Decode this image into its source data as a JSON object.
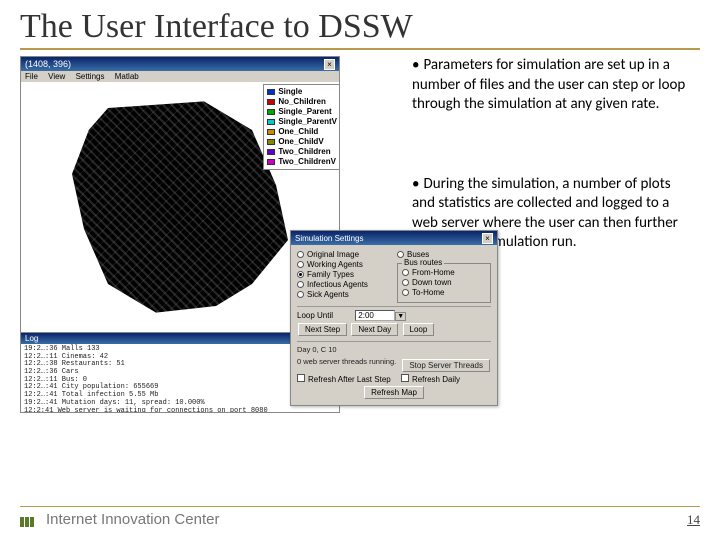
{
  "title": "The User Interface to DSSW",
  "bullets": [
    "Parameters for simulation are set up in a number of files and the user can step or loop through the simulation at any given rate.",
    "During the simulation, a number of plots and statistics are collected and logged to a web server where the user can then further analyze the simulation run."
  ],
  "app": {
    "title": "(1408, 396)",
    "menus": [
      "File",
      "View",
      "Settings",
      "Matlab"
    ],
    "legend": [
      {
        "label": "Single",
        "color": "#0033cc"
      },
      {
        "label": "No_Children",
        "color": "#cc0000"
      },
      {
        "label": "Single_Parent",
        "color": "#00aa00"
      },
      {
        "label": "Single_ParentV",
        "color": "#00cccc"
      },
      {
        "label": "One_Child",
        "color": "#cc8800"
      },
      {
        "label": "One_ChildV",
        "color": "#888800"
      },
      {
        "label": "Two_Children",
        "color": "#6600cc"
      },
      {
        "label": "Two_ChildrenV",
        "color": "#cc00cc"
      }
    ],
    "log_title": "Log",
    "log_lines": [
      "19:2…:36 Malls 133",
      "12:2…:11 Cinemas: 42",
      "12:2…:38 Restaurants: 51",
      "12:2…:36 Cars",
      "12:2…:11 Bus: 0",
      "12:2…:41 City population: 655669",
      "12:2…:41 Total infection 5.55 Mb",
      "19:2…:41 Mutation days: 11, spread: 10.000%",
      "12:2:41 Web server is waiting for connections on port 8080"
    ]
  },
  "settings": {
    "title": "Simulation Settings",
    "left_radios": [
      "Original Image",
      "Working Agents",
      "Family Types",
      "Infectious Agents",
      "Sick Agents"
    ],
    "routes_label": "Bus routes",
    "right_radios": [
      "Buses",
      "From-Home",
      "Down town",
      "To-Home"
    ],
    "loop_label": "Loop Until",
    "loop_value": "2:00",
    "btn_next_step": "Next Step",
    "btn_next_day": "Next Day",
    "btn_loop": "Loop",
    "status1": "Day 0, C 10",
    "status2": "0 web server threads running.",
    "btn_stop": "Stop Server Threads",
    "cb_refresh_last": "Refresh After Last Step",
    "cb_refresh_daily": "Refresh Daily",
    "btn_refresh_map": "Refresh Map"
  },
  "footer": {
    "brand": "Internet Innovation Center",
    "page": "14"
  }
}
